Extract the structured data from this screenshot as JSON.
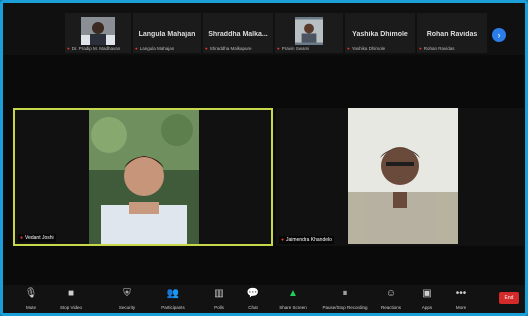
{
  "participants_strip": [
    {
      "name": "",
      "sub_label": "Dr. Pradip M. Madhavan"
    },
    {
      "name": "Langula Mahajan",
      "sub_label": "Langula Mahajan"
    },
    {
      "name": "Shraddha Malka...",
      "sub_label": "Shraddha Malkapure"
    },
    {
      "name": "",
      "sub_label": "Pravin Swami"
    },
    {
      "name": "Yashika Dhimole",
      "sub_label": "Yashika Dhimole"
    },
    {
      "name": "Rohan Ravidas",
      "sub_label": "Rohan Ravidas"
    }
  ],
  "main_tiles": [
    {
      "name": "Vedant Joshi"
    },
    {
      "name": "Jaimendra Khandelo"
    }
  ],
  "toolbar": {
    "items": [
      {
        "label": "Mute",
        "icon": "microphone-icon"
      },
      {
        "label": "Stop Video",
        "icon": "video-camera-icon"
      },
      {
        "label": "Security",
        "icon": "shield-icon"
      },
      {
        "label": "Participants",
        "icon": "participants-icon"
      },
      {
        "label": "Polls",
        "icon": "chart-icon"
      },
      {
        "label": "Chat",
        "icon": "chat-icon"
      },
      {
        "label": "Share Screen",
        "icon": "share-screen-icon"
      },
      {
        "label": "Pause/Stop Recording",
        "icon": "record-icon"
      },
      {
        "label": "Reactions",
        "icon": "smiley-icon"
      },
      {
        "label": "Apps",
        "icon": "apps-icon"
      },
      {
        "label": "More",
        "icon": "more-icon"
      }
    ],
    "end_label": "End"
  },
  "colors": {
    "border": "#1a9fd8",
    "end_button": "#d52a2a",
    "active_speaker": "#c7d84a"
  }
}
